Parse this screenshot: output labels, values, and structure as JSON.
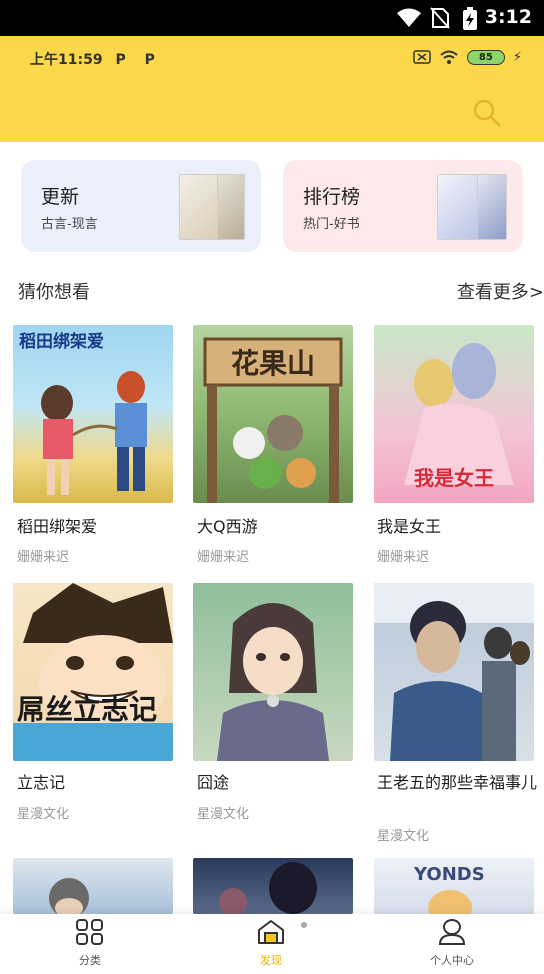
{
  "system_bar": {
    "time": "3:12"
  },
  "inner_status": {
    "time": "上午11:59",
    "app_icons": [
      "P",
      "P"
    ],
    "battery": "85"
  },
  "cards": [
    {
      "title": "更新",
      "subtitle": "古言-现言",
      "bg": "#ebeefb"
    },
    {
      "title": "排行榜",
      "subtitle": "热门-好书",
      "bg": "#fde8ea"
    }
  ],
  "section": {
    "title": "猜你想看",
    "more": "查看更多>"
  },
  "comics": [
    {
      "title": "稻田绑架爱",
      "author": "姗姗来迟",
      "cover_text": "稻田绑架爱"
    },
    {
      "title": "大Q西游",
      "author": "姗姗来迟",
      "cover_text": "花果山"
    },
    {
      "title": "我是女王",
      "author": "姗姗来迟",
      "cover_text": "我是女王"
    },
    {
      "title": "立志记",
      "author": "星漫文化",
      "cover_text": "屌丝立志记"
    },
    {
      "title": "囧途",
      "author": "星漫文化"
    },
    {
      "title": "王老五的那些幸福事儿",
      "author": "星漫文化"
    }
  ],
  "partial_row": {
    "cover_text": "YONDS"
  },
  "nav": [
    {
      "label": "分类",
      "icon": "grid-icon"
    },
    {
      "label": "发现",
      "icon": "home-icon",
      "active": true
    },
    {
      "label": "个人中心",
      "icon": "user-icon"
    }
  ],
  "colors": {
    "header": "#fad84a",
    "accent": "#f0b400"
  }
}
